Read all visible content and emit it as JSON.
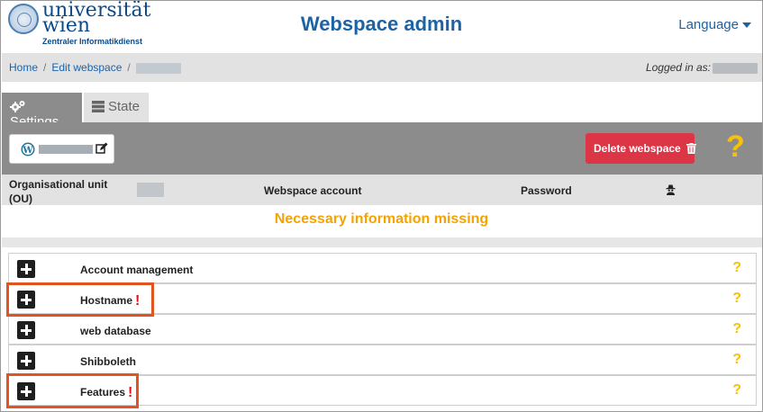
{
  "header": {
    "logo_line1": "universität",
    "logo_line2": "wien",
    "logo_sub": "Zentraler Informatikdienst",
    "title": "Webspace admin",
    "language_label": "Language"
  },
  "breadcrumb": {
    "home": "Home",
    "separator": "/",
    "edit": "Edit webspace",
    "logged_in_label": "Logged in as:"
  },
  "tabs": {
    "settings": "Settings",
    "state": "State"
  },
  "panel": {
    "delete_label": "Delete webspace",
    "help_symbol": "?"
  },
  "info": {
    "ou_label": "Organisational unit (OU)",
    "account_label": "Webspace account",
    "password_label": "Password",
    "missing_text": "Necessary information missing"
  },
  "sections": [
    {
      "label": "Account management",
      "warning": ""
    },
    {
      "label": "Hostname",
      "warning": "!"
    },
    {
      "label": "web database",
      "warning": ""
    },
    {
      "label": "Shibboleth",
      "warning": ""
    },
    {
      "label": "Features",
      "warning": "!"
    }
  ],
  "help_symbol": "?",
  "colors": {
    "brand_blue": "#1c63a6",
    "panel_gray": "#8c8c8c",
    "delete_red": "#dc3545",
    "help_yellow": "#f6c10c",
    "missing_orange": "#f5a300",
    "highlight": "#e0541f"
  }
}
